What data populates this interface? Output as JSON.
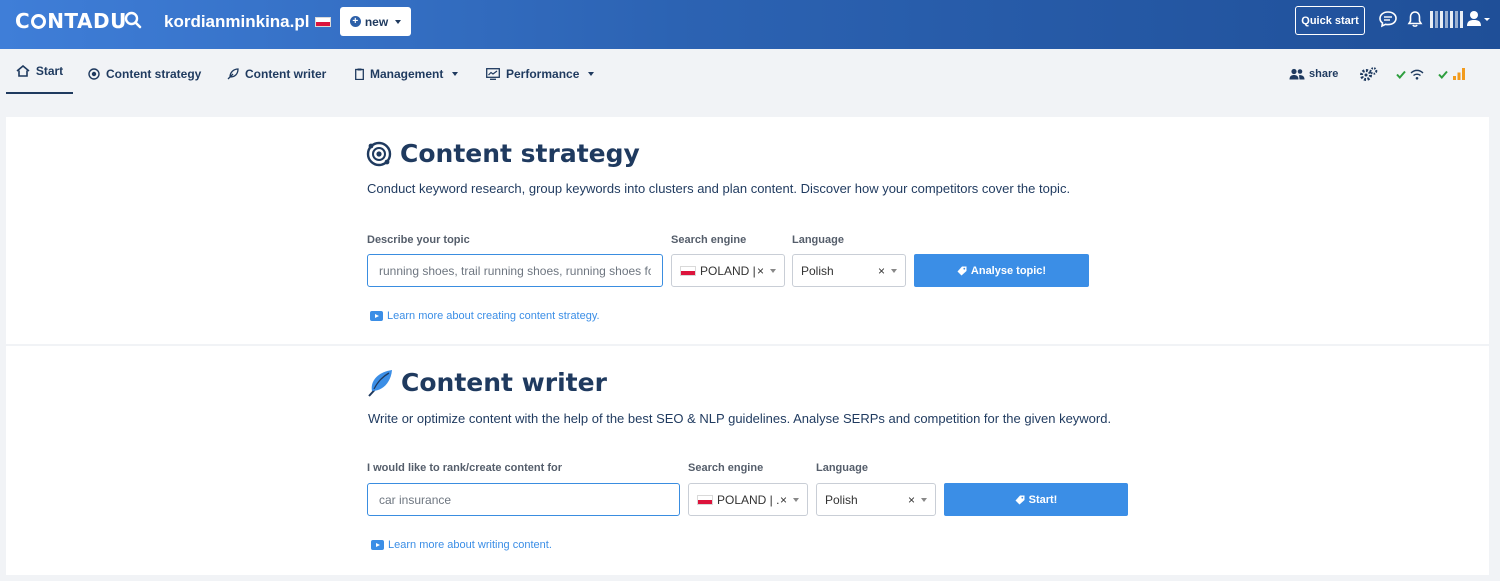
{
  "topbar": {
    "logo_before": "C",
    "logo_after": "NTADU",
    "domain": "kordianminkina.pl",
    "new_label": "new",
    "quick_start_label": "Quick start"
  },
  "nav": {
    "items": [
      {
        "label": "Start",
        "icon": "home-icon"
      },
      {
        "label": "Content strategy",
        "icon": "strategy-icon"
      },
      {
        "label": "Content writer",
        "icon": "feather-icon"
      },
      {
        "label": "Management",
        "icon": "clipboard-icon"
      },
      {
        "label": "Performance",
        "icon": "performance-icon"
      }
    ],
    "share_label": "share"
  },
  "content_strategy": {
    "title": "Content strategy",
    "description": "Conduct keyword research, group keywords into clusters and plan content. Discover how your competitors cover the topic.",
    "topic_label": "Describe your topic",
    "topic_placeholder": "running shoes, trail running shoes, running shoes for",
    "engine_label": "Search engine",
    "engine_value": "POLAND | ...",
    "language_label": "Language",
    "language_value": "Polish",
    "button_label": "Analyse topic!",
    "learn_more": "Learn more about creating content strategy."
  },
  "content_writer": {
    "title": "Content writer",
    "description": "Write or optimize content with the help of the best SEO & NLP guidelines. Analyse SERPs and competition for the given keyword.",
    "keyword_label": "I would like to rank/create content for",
    "keyword_placeholder": "car insurance",
    "engine_label": "Search engine",
    "engine_value": "POLAND | ...",
    "language_label": "Language",
    "language_value": "Polish",
    "button_label": "Start!",
    "learn_more": "Learn more about writing content."
  },
  "colors": {
    "brand_dark": "#1f3a5f",
    "accent_blue": "#3b8ee6",
    "check_green": "#2e9e3e",
    "signal_orange": "#f29b1d"
  }
}
